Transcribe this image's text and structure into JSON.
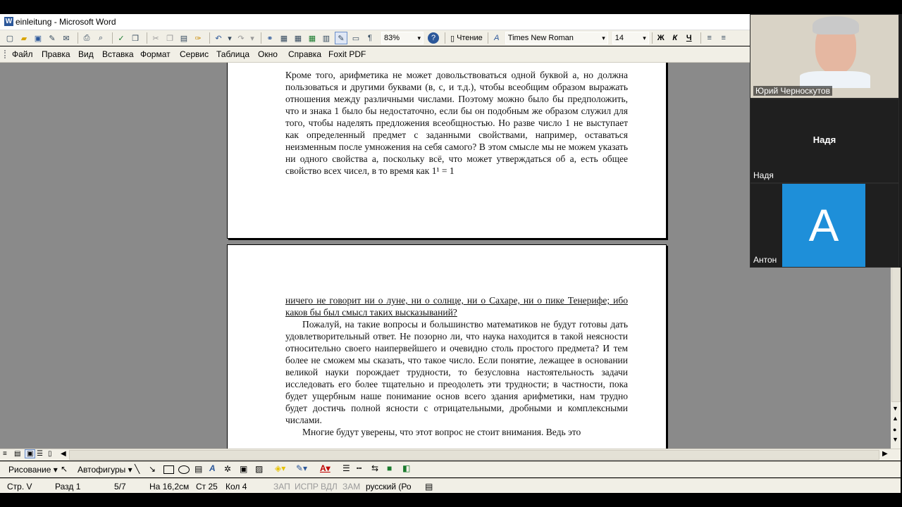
{
  "window": {
    "title": "einleitung - Microsoft Word"
  },
  "toolbar": {
    "zoom": "83%",
    "reading_mode": "Чтение",
    "font_name": "Times New Roman",
    "font_size": "14",
    "bold": "Ж",
    "italic": "К",
    "underline": "Ч"
  },
  "menu": [
    "Файл",
    "Правка",
    "Вид",
    "Вставка",
    "Формат",
    "Сервис",
    "Таблица",
    "Окно",
    "Справка",
    "Foxit PDF"
  ],
  "document": {
    "page1_text": "Кроме того, арифметика не может довольствоваться одной буквой a, но должна пользоваться и другими буквами (в, с, и т.д.), чтобы всеобщим образом выражать отношения между различными числами. Поэтому можно было бы предположить, что и знака 1 было бы недостаточно, если бы он подобным же образом служил для того, чтобы наделять предложения всеобщностью. Но разве число 1 не выступает как определенный предмет с заданными свойствами, например, оставаться неизменным после умножения на себя самого? В этом смысле мы не можем указать ни одного свойства a, поскольку всё, что может утверждаться об a, есть общее свойство всех чисел, в то время как 1¹ = 1",
    "page2_p1": "ничего не говорит ни о луне, ни о солнце, ни о Сахаре, ни о пике Тенерифе; ибо каков бы был смысл таких высказываний?",
    "page2_p2": "Пожалуй, на такие вопросы и большинство математиков не будут готовы дать удовлетворительный ответ. Не позорно ли, что наука находится в такой неясности относительно своего наипервейшего и очевидно столь простого предмета? И тем более не сможем мы сказать, что такое число. Если понятие, лежащее в основании великой науки порождает трудности, то безусловна настоятельность задачи исследовать его более тщательно и преодолеть эти трудности; в частности, пока будет ущербным наше понимание основ всего здания арифметики, нам трудно будет достичь полной ясности с отрицательными, дробными и комплексными числами.",
    "page2_p3": "Многие будут уверены, что этот вопрос не стоит внимания. Ведь это"
  },
  "drawing_toolbar": {
    "drawing": "Рисование",
    "autoshapes": "Автофигуры"
  },
  "status": {
    "page": "Стр. V",
    "section": "Разд 1",
    "pages": "5/7",
    "at": "На 16,2см",
    "line": "Ст 25",
    "col": "Кол 4",
    "rec": "ЗАП",
    "trk": "ИСПР",
    "ext": "ВДЛ",
    "ovr": "ЗАМ",
    "lang": "русский (Ро"
  },
  "video": {
    "participants": [
      {
        "name": "Юрий Черноскутов"
      },
      {
        "name": "Надя",
        "center_label": "Надя"
      },
      {
        "name": "Антон",
        "avatar_letter": "A"
      }
    ],
    "avatar_color": "#1e8fd9"
  }
}
